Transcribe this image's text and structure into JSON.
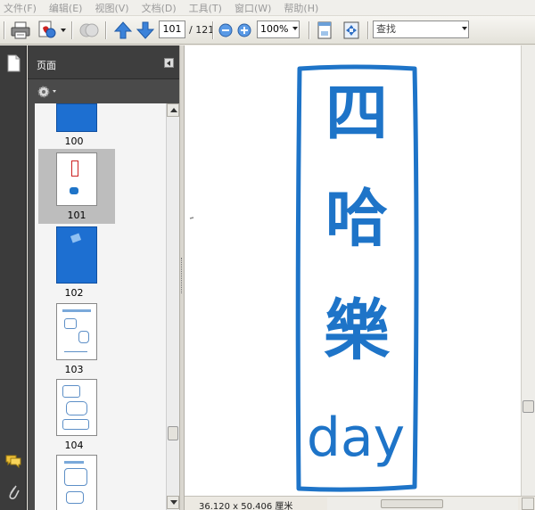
{
  "menu": [
    "文件(F)",
    "编辑(E)",
    "视图(V)",
    "文档(D)",
    "工具(T)",
    "窗口(W)",
    "帮助(H)"
  ],
  "toolbar": {
    "current_page": "101",
    "total_pages": "/ 121",
    "zoom": "100%",
    "find_placeholder": "查找"
  },
  "panel": {
    "title": "页面"
  },
  "thumbnails": [
    {
      "label": "100",
      "kind": "blue"
    },
    {
      "label": "101",
      "kind": "sketch",
      "selected": true
    },
    {
      "label": "102",
      "kind": "blue-icon"
    },
    {
      "label": "103",
      "kind": "doodle"
    },
    {
      "label": "104",
      "kind": "doodle"
    },
    {
      "label": "",
      "kind": "doodle"
    }
  ],
  "document": {
    "sign_chars": [
      "四",
      "哈",
      "樂"
    ],
    "sign_word": "day",
    "ink_color": "#1e74c8"
  },
  "status": {
    "page_size": "36.120 x 50.406 厘米"
  }
}
